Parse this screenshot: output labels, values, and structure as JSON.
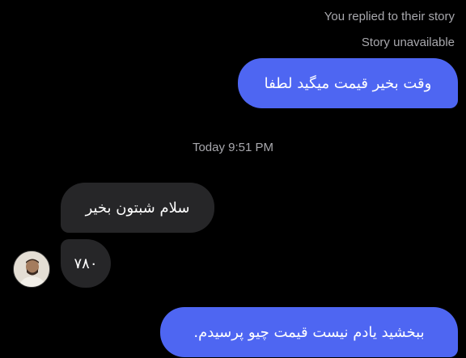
{
  "story": {
    "replied_text": "You replied to their story",
    "unavailable_text": "Story unavailable"
  },
  "timestamp": "Today 9:51 PM",
  "messages": [
    {
      "direction": "outgoing",
      "text": "وقت بخیر قیمت میگید لطفا"
    },
    {
      "direction": "incoming",
      "text": "سلام شبتون بخیر"
    },
    {
      "direction": "incoming",
      "text": "۷۸۰"
    },
    {
      "direction": "outgoing",
      "text": "ببخشید یادم نیست قیمت چیو پرسیدم."
    }
  ],
  "colors": {
    "outgoing_bubble": "#4e66f2",
    "incoming_bubble": "#262628",
    "background": "#000000",
    "meta_text": "#a8a8ad"
  },
  "icons": {
    "avatar": "contact-avatar"
  }
}
